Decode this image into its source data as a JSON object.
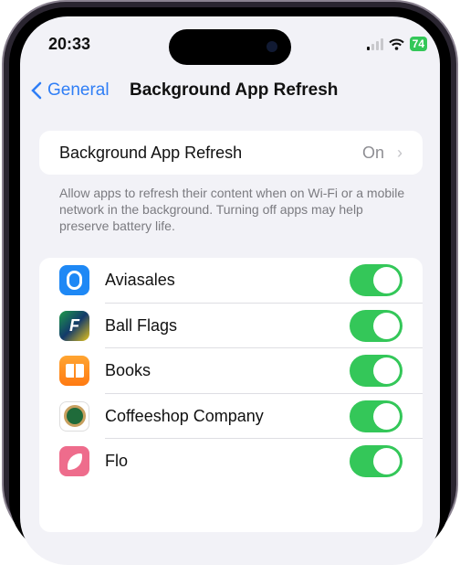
{
  "status": {
    "time": "20:33",
    "battery": "74"
  },
  "nav": {
    "back_label": "General",
    "title": "Background App Refresh"
  },
  "setting": {
    "label": "Background App Refresh",
    "value": "On"
  },
  "description": "Allow apps to refresh their content when on Wi-Fi or a mobile network in the background. Turning off apps may help preserve battery life.",
  "apps": [
    {
      "name": "Aviasales",
      "enabled": true,
      "color": "#1e88f5"
    },
    {
      "name": "Ball Flags",
      "enabled": true,
      "color": "#123a6b"
    },
    {
      "name": "Books",
      "enabled": true,
      "color": "#ff8a1e"
    },
    {
      "name": "Coffeeshop Company",
      "enabled": true,
      "color": "#1f6b3a"
    },
    {
      "name": "Flo",
      "enabled": true,
      "color": "#ee6c8c"
    }
  ]
}
